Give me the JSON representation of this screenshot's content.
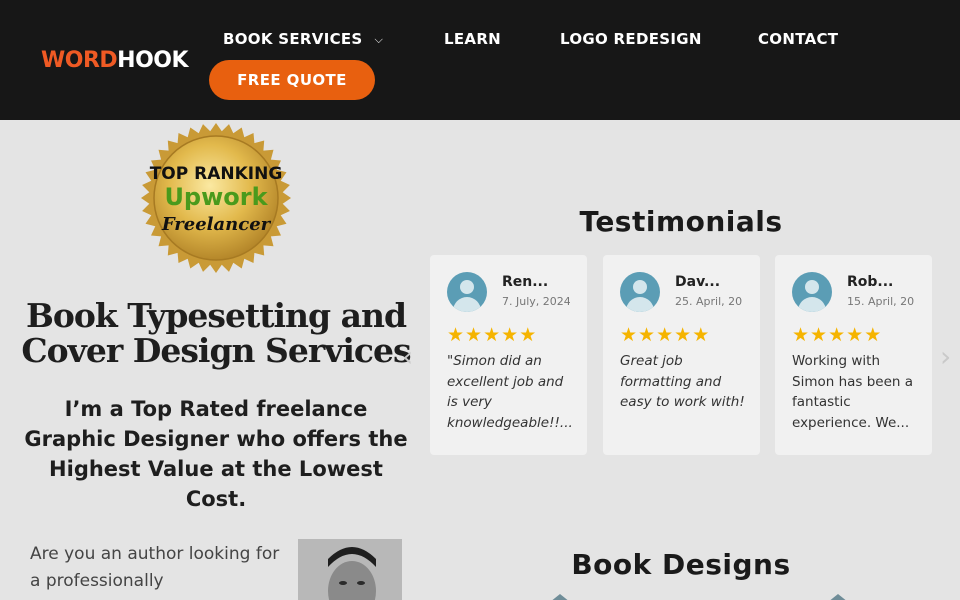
{
  "header": {
    "logo_part1": "WORD",
    "logo_part2": "HOOK",
    "nav": [
      {
        "label": "BOOK SERVICES",
        "has_dropdown": true
      },
      {
        "label": "LEARN"
      },
      {
        "label": "LOGO REDESIGN"
      },
      {
        "label": "CONTACT"
      }
    ],
    "quote_button": "FREE QUOTE",
    "chevron_glyph": "⌵",
    "accent_color": "#e8600f"
  },
  "badge": {
    "line1": "TOP RANKING",
    "line2": "Upwork",
    "line3": "Freelancer"
  },
  "hero": {
    "title": "Book Typesetting and Cover Design Services",
    "subtitle": "I’m a Top Rated freelance Graphic Designer who offers the Highest Value at the Lowest Cost.",
    "intro": "Are you an author looking for a professionally"
  },
  "testimonials": {
    "title": "Testimonials",
    "prev_glyph": "‹",
    "next_glyph": "›",
    "cards": [
      {
        "name": "Ren...",
        "date": "7. July, 2024.",
        "text": "\"Simon did an excellent job and is very knowledgeable!!...",
        "stars": 5
      },
      {
        "name": "Dav...",
        "date": "25. April, 20...",
        "text": "Great job formatting and easy to work with!",
        "stars": 5
      },
      {
        "name": "Rob...",
        "date": "15. April, 20...",
        "text": "Working with Simon has been a fantastic experience. We...",
        "stars": 5
      }
    ]
  },
  "books": {
    "title": "Book Designs"
  }
}
